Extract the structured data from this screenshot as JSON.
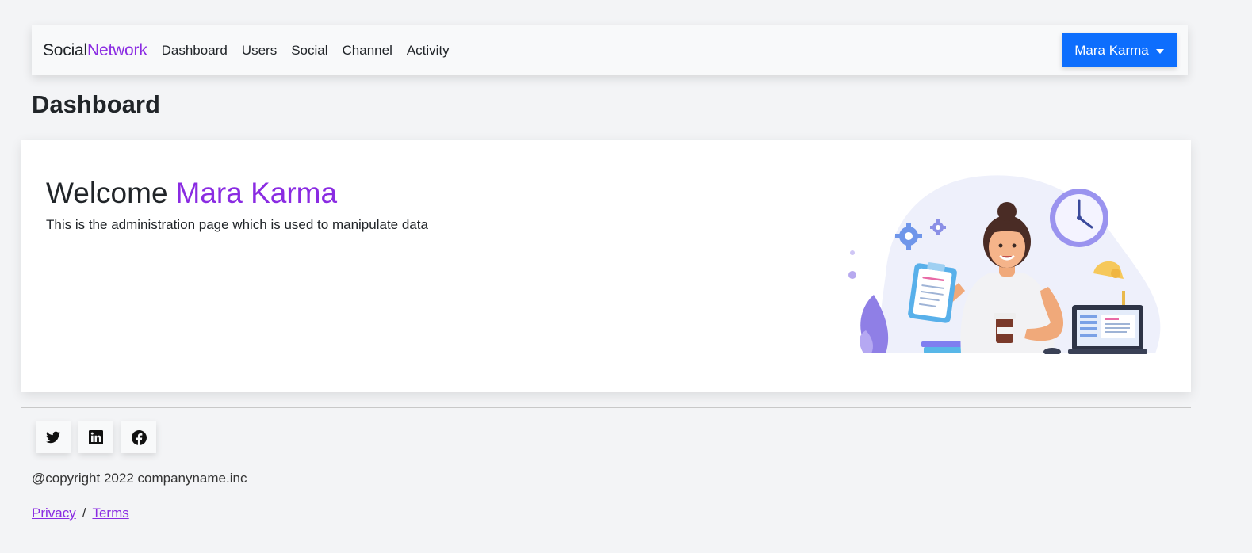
{
  "navbar": {
    "brand_part1": "Social",
    "brand_part2": "Network",
    "links": [
      "Dashboard",
      "Users",
      "Social",
      "Channel",
      "Activity"
    ],
    "user_button": "Mara Karma"
  },
  "page": {
    "title": "Dashboard"
  },
  "welcome": {
    "greeting": "Welcome",
    "name": "Mara Karma",
    "subtitle": "This is the administration page which is used to manipulate data"
  },
  "footer": {
    "social_icons": [
      "twitter-icon",
      "linkedin-icon",
      "facebook-icon"
    ],
    "copyright": "@copyright 2022 companyname.inc",
    "privacy": "Privacy",
    "separator": "/",
    "terms": "Terms"
  },
  "colors": {
    "accent": "#8a2be2",
    "primary_button": "#0d6efd",
    "background": "#f3f4f6"
  }
}
